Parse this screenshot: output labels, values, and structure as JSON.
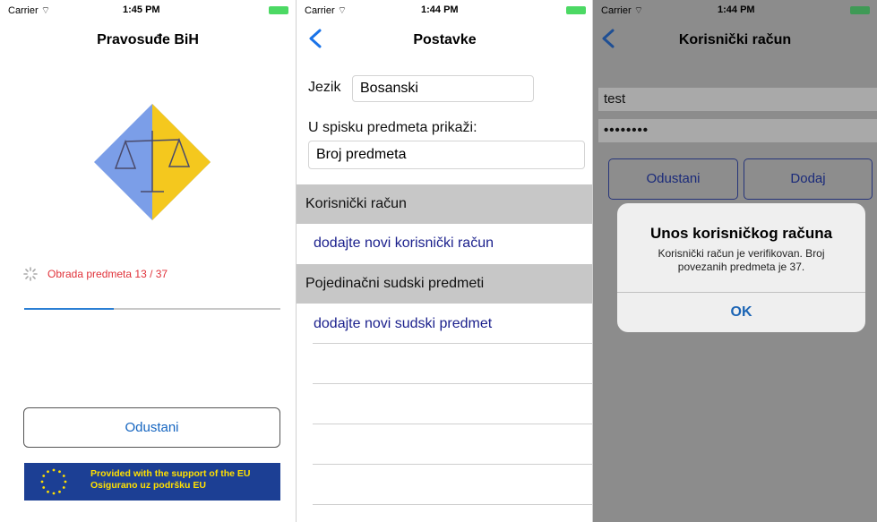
{
  "screen1": {
    "status": {
      "carrier": "Carrier",
      "time": "1:45 PM"
    },
    "title": "Pravosuđe BiH",
    "progress": {
      "text": "Obrada predmeta 13 / 37",
      "fraction": 0.35
    },
    "cancel_label": "Odustani",
    "eu_banner": {
      "line1": "Provided with the support of the EU",
      "line2": "Osigurano uz podršku EU"
    }
  },
  "screen2": {
    "status": {
      "carrier": "Carrier",
      "time": "1:44 PM"
    },
    "title": "Postavke",
    "language_label": "Jezik",
    "language_value": "Bosanski",
    "list_label": "U spisku predmeta prikaži:",
    "list_value": "Broj predmeta",
    "section_accounts": "Korisnički račun",
    "add_account": "dodajte novi korisnički račun",
    "section_cases": "Pojedinačni sudski predmeti",
    "add_case": "dodajte novi sudski predmet"
  },
  "screen3": {
    "status": {
      "carrier": "Carrier",
      "time": "1:44 PM"
    },
    "title": "Korisnički račun",
    "username": "test",
    "password": "••••••••",
    "cancel_label": "Odustani",
    "add_label": "Dodaj",
    "alert": {
      "title": "Unos korisničkog računa",
      "message": "Korisnički račun je verifikovan. Broj povezanih predmeta je 37.",
      "ok": "OK"
    }
  },
  "colors": {
    "accent_blue": "#1565c0",
    "progress_red": "#e0323a",
    "link_navy": "#1a1f8c",
    "eu_blue": "#1c3f94",
    "eu_yellow": "#ffe000"
  }
}
